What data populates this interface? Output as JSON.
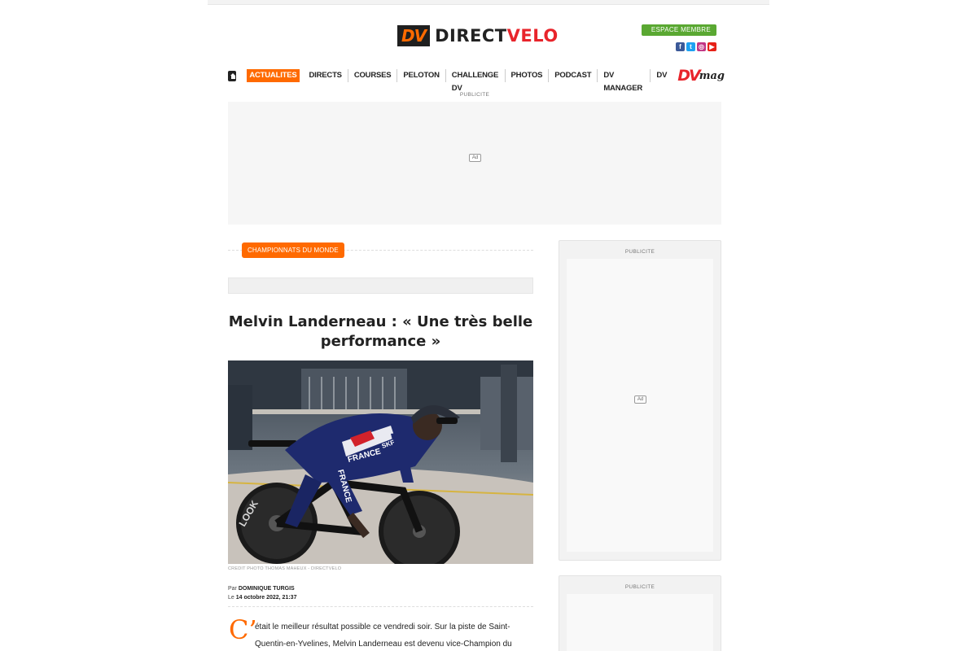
{
  "header": {
    "logo_mark": "DV",
    "logo_text_part1": "DIRECT",
    "logo_text_part2": "VELO",
    "member_button": "ESPACE MEMBRE",
    "socials": [
      {
        "icon": "facebook-icon",
        "glyph": "f"
      },
      {
        "icon": "twitter-icon",
        "glyph": "t"
      },
      {
        "icon": "instagram-icon",
        "glyph": "◎"
      },
      {
        "icon": "youtube-icon",
        "glyph": "▶"
      }
    ]
  },
  "nav": {
    "items": [
      "ACTUALITES",
      "DIRECTS",
      "COURSES",
      "PELOTON",
      "CHALLENGE DV",
      "PHOTOS",
      "PODCAST",
      "DV MANAGER",
      "DV"
    ],
    "active": "ACTUALITES",
    "mag_dv": "DV",
    "mag_text": "mag"
  },
  "ads": {
    "label": "PUBLICITE",
    "badge": "Ad"
  },
  "article": {
    "category": "CHAMPIONNATS DU MONDE",
    "title": "Melvin Landerneau : « Une très belle performance »",
    "photo_credit": "CREDIT PHOTO THOMAS MAHEUX - DIRECTVELO",
    "photo_text": {
      "jersey_chest": "FRANCE",
      "jersey_side": "FRANCE",
      "jersey_sponsor": "SKF",
      "wheel_brand": "LOOK"
    },
    "by_prefix": "Par",
    "author": "DOMINIQUE TURGIS",
    "date_prefix": "Le",
    "date": "14 octobre 2022, 21:37",
    "dropcap": "C’",
    "lines": [
      "était le meilleur résultat possible ce vendredi soir. Sur la piste de Saint-",
      "Quentin-en-Yvelines, Melvin Landerneau est devenu vice-Champion du"
    ]
  },
  "colors": {
    "accent": "#ff6a00",
    "member_green": "#5aa832",
    "brand_red": "#e8242b"
  }
}
